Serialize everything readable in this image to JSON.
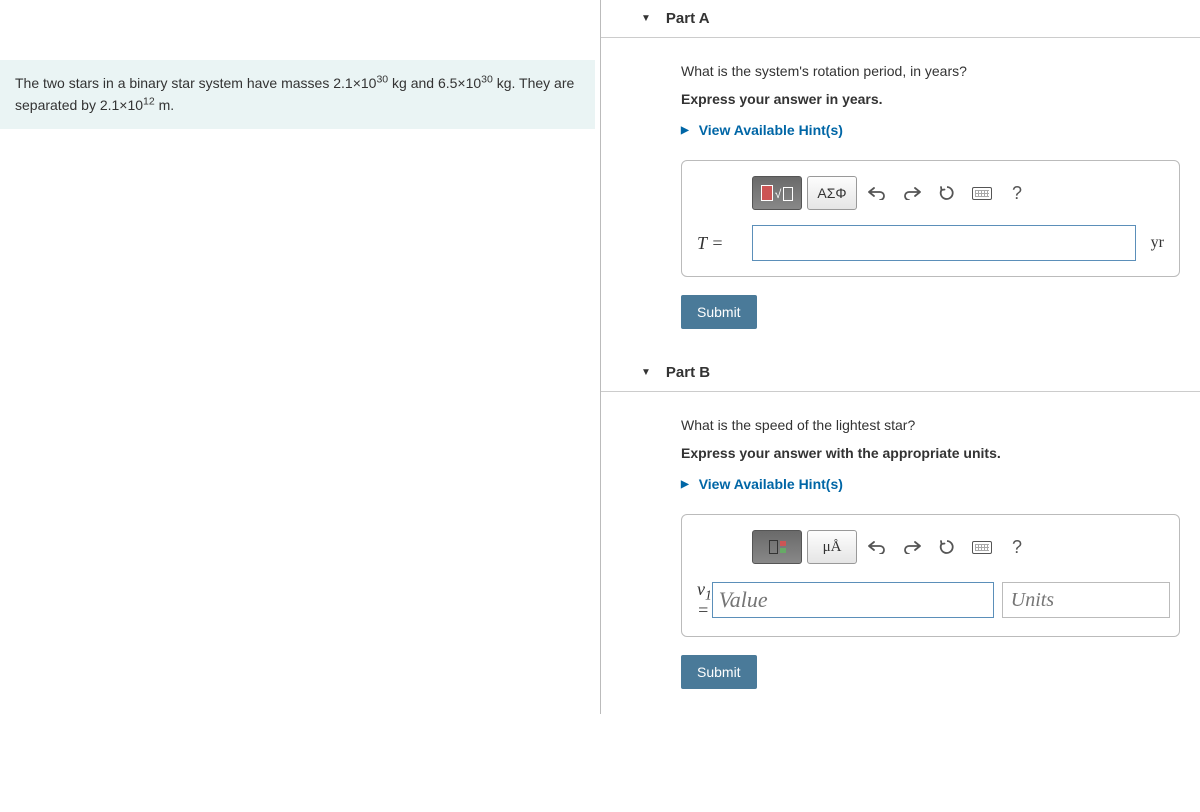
{
  "problem": {
    "text_html": "The two stars in a binary star system have masses 2.1×10<sup>30</sup> kg and 6.5×10<sup>30</sup> kg. They are separated by 2.1×10<sup>12</sup> m."
  },
  "partA": {
    "title": "Part A",
    "question": "What is the system's rotation period, in years?",
    "instruction": "Express your answer in years.",
    "hints_label": "View Available Hint(s)",
    "var_label_html": "<i>T</i> =",
    "unit_suffix": "yr",
    "toolbar": {
      "greek": "ΑΣΦ",
      "help": "?"
    },
    "submit": "Submit"
  },
  "partB": {
    "title": "Part B",
    "question": "What is the speed of the lightest star?",
    "instruction": "Express your answer with the appropriate units.",
    "hints_label": "View Available Hint(s)",
    "var_label_html": "<i>v</i><sub>1</sub> =",
    "value_placeholder": "Value",
    "units_placeholder": "Units",
    "toolbar": {
      "units_btn": "μÅ",
      "help": "?"
    },
    "submit": "Submit"
  }
}
